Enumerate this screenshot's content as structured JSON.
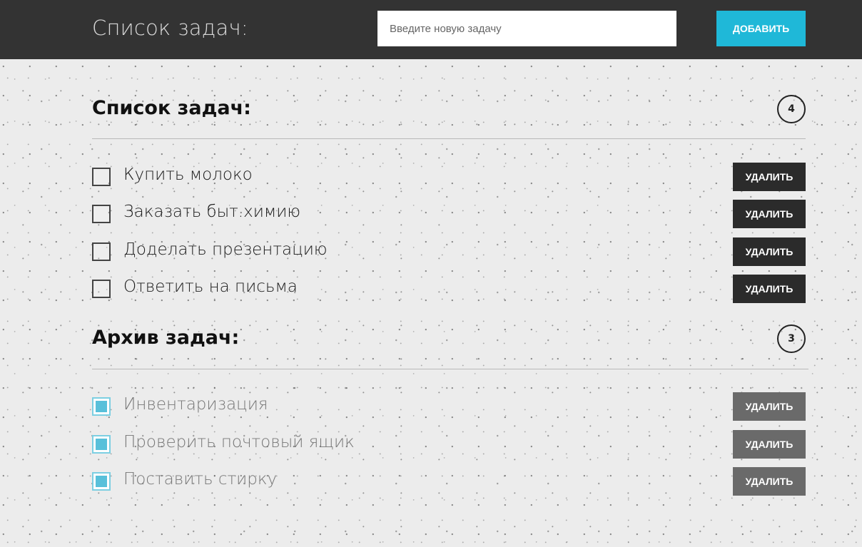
{
  "header": {
    "title": "Список задач:",
    "input_placeholder": "Введите новую задачу",
    "input_value": "",
    "add_label": "ДОБАВИТЬ"
  },
  "active": {
    "heading": "Список задач:",
    "count": "4",
    "tasks": [
      {
        "label": "Купить молоко",
        "done": false
      },
      {
        "label": "Заказать быт.химию",
        "done": false
      },
      {
        "label": "Доделать презентацию",
        "done": false
      },
      {
        "label": "Ответить на письма",
        "done": false
      }
    ]
  },
  "archive": {
    "heading": "Архив задач:",
    "count": "3",
    "tasks": [
      {
        "label": "Инвентаризация",
        "done": true
      },
      {
        "label": "Проверить почтовый ящик",
        "done": true
      },
      {
        "label": "Поставить стирку",
        "done": true
      }
    ]
  },
  "delete_label": "УДАЛИТЬ",
  "colors": {
    "topbar": "#333333",
    "accent": "#1fb8d8",
    "checked_fill": "#58c0da",
    "delete_active": "#2b2b2b",
    "delete_archived": "#6a6a6a"
  }
}
